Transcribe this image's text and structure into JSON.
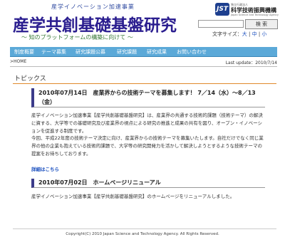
{
  "header": {
    "tagline": "産学イノベーション加速事業",
    "title": "産学共創基礎基盤研究",
    "subtitle": "〜 知のプラットフォームの構築に向けて 〜",
    "logo": {
      "mark": "JST",
      "small": "独立行政法人",
      "name": "科学技術振興機構",
      "en": "Japan Science and Technology Agency"
    },
    "search_button": "検 索",
    "font_size_label": "文字サイズ：",
    "font_size_large": "大",
    "font_size_medium": "中",
    "font_size_small": "小"
  },
  "nav": {
    "items": [
      "制度概要",
      "テーマ募集",
      "研究課題公募",
      "研究課題",
      "研究成果",
      "お問い合わせ"
    ]
  },
  "breadcrumb": {
    "home": ">HOME",
    "last_update": "Last update：2010/7/14"
  },
  "topics": {
    "title": "トピックス",
    "news": [
      {
        "heading": "2010年07月14日　産業界からの技術テーマを募集します！ 7／14（水）〜8／13（金）",
        "paragraphs": [
          "産学イノベーション加速事業【産学共創基礎基盤研究】は、産業界の共通する技術的課題（技術テーマ）の解決に資する、大学等での基礎研究及び産業界の視点による研究の推進と成果の共有を図り、オープン・イノベーションを促進する制度です。",
          "今回、平成22年度の技術テーマ決定に向け、産業界からの技術テーマを募集いたします。自社だけでなく同じ業界の他の企業も抱えている技術的課題で、大学等の研究開発力を活かして解決しようとするような技術テーマの提案をお待ちしております。"
        ],
        "more": "詳細はこちら"
      },
      {
        "heading": "2010年07月02日　ホームページリニューアル",
        "paragraphs": [
          "産学イノベーション加速事業【産学共創基礎基盤研究】のホームページをリニューアルしました。"
        ]
      }
    ]
  },
  "footer": {
    "copyright": "Copyright(C) 2010 Japan Science and Technology Agency. All Rights Reserved."
  },
  "colors": {
    "title": "#2a1d8f",
    "nav_bg": "#5ba9d8",
    "topics_rule": "#e08a2c",
    "news_marker": "#3b3b8a"
  }
}
